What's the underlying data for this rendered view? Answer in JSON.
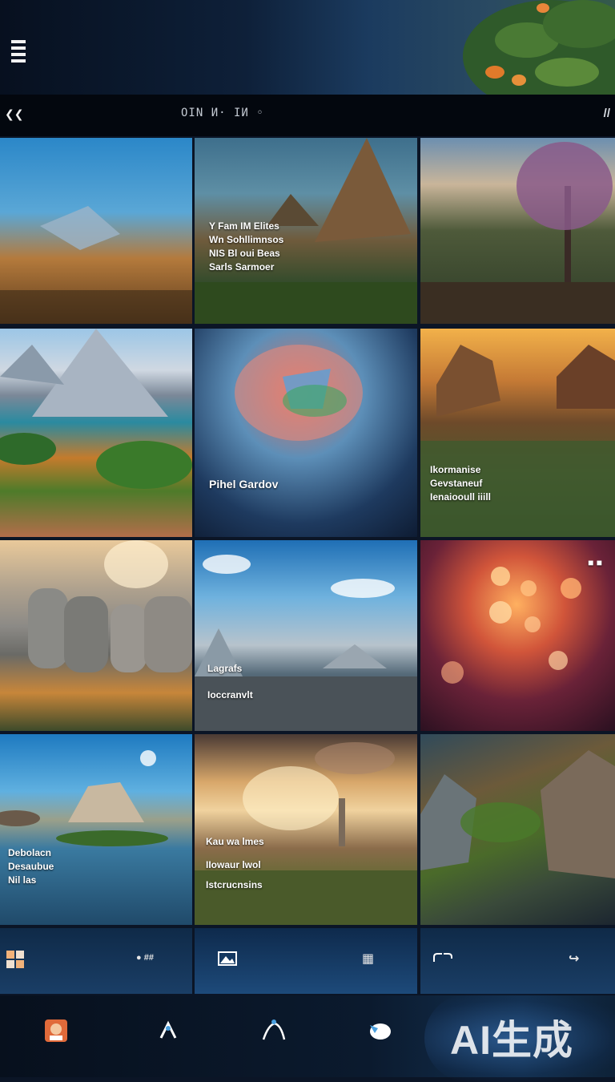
{
  "header": {
    "menu_icon": "hamburger-menu-icon"
  },
  "subbar": {
    "back_icon": "chevron-left-icon",
    "title": "OIN  И·  IИ ◦",
    "right_label": "//"
  },
  "gallery": {
    "tiles": [
      {
        "captions": []
      },
      {
        "captions": [
          "Y Fam  IM Elites",
          "Wn  Sohllimnsos",
          "NIS  Bl oui Beas",
          "Sarls  Sarmoer"
        ]
      },
      {
        "captions": []
      },
      {
        "captions": []
      },
      {
        "captions": [
          "Pihel Gardov"
        ]
      },
      {
        "captions": [
          "Ikormanise",
          "Gevstaneuf",
          "Ienaiooull iiill"
        ]
      },
      {
        "captions": []
      },
      {
        "captions": [
          "Lagrafs",
          "Ioccranvlt"
        ]
      },
      {
        "captions": [
          "■ ■"
        ]
      },
      {
        "captions": [
          "Debolacn",
          "Desaubue",
          "Nil las"
        ]
      },
      {
        "captions": [
          "Kau wa lmes",
          "IIowaur lwol",
          "Istcrucnsins"
        ]
      },
      {
        "captions": []
      }
    ]
  },
  "actions": {
    "a1_icon": "grid-icon",
    "a1_label": "● ##",
    "a2_icon": "image-icon",
    "a2_label": "▦",
    "a3_icon": "link-icon",
    "a3_label": "↪"
  },
  "bottom_nav": {
    "watermark": "AI生成"
  },
  "colors": {
    "background": "#0b1526",
    "accent": "#1a3e66"
  }
}
